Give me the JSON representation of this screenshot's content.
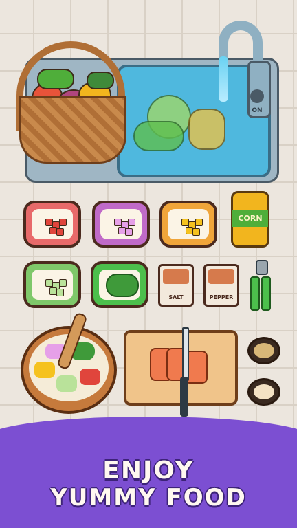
{
  "kitchen": {
    "faucet_label": "ON",
    "can_label": "CORN",
    "shakers": [
      {
        "label": "SALT"
      },
      {
        "label": "PEPPER"
      }
    ]
  },
  "trays": [
    {
      "item": "diced-tomato",
      "color": "#e0453c",
      "rim": "#e86a6a"
    },
    {
      "item": "diced-onion",
      "color": "#e6a0e8",
      "rim": "#c06ac8"
    },
    {
      "item": "corn-kernels",
      "color": "#f5c21f",
      "rim": "#f0a53a"
    },
    {
      "item": "diced-cucumber",
      "color": "#b9e29a",
      "rim": "#7fc86a"
    },
    {
      "item": "cilantro",
      "color": "#3f9a3a",
      "rim": "#4cbf4c"
    }
  ],
  "banner": {
    "line1": "ENJOY",
    "line2": "YUMMY FOOD",
    "color": "#7c4fd2"
  }
}
